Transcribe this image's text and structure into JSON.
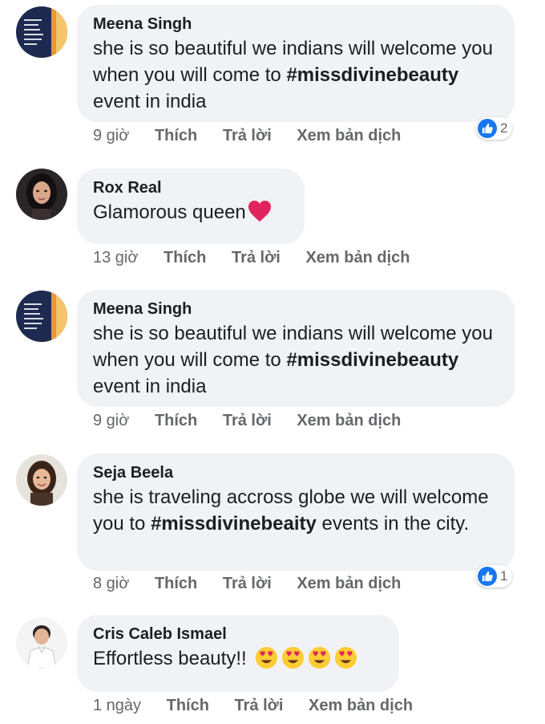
{
  "comments": [
    {
      "author": "Meena Singh",
      "text_1": "she is so beautiful we indians will welcome you when you will come to",
      "hashtag": "#missdivinebeauty",
      "text_2": " event in india",
      "time": "9 giờ",
      "like": "Thích",
      "reply": "Trả lời",
      "translate": "Xem bản dịch",
      "reaction_count": "2",
      "avatar": "book-cover-avatar"
    },
    {
      "author": "Rox Real",
      "text_1": "Glamorous queen",
      "time": "13 giờ",
      "like": "Thích",
      "reply": "Trả lời",
      "translate": "Xem bản dịch",
      "emoji": "red-heart-icon",
      "avatar": "woman-dark-hair-avatar"
    },
    {
      "author": "Meena Singh",
      "text_1": "she is so beautiful we indians will welcome you when you will come to",
      "hashtag": "#missdivinebeauty",
      "text_2": " event in india",
      "time": "9 giờ",
      "like": "Thích",
      "reply": "Trả lời",
      "translate": "Xem bản dịch",
      "avatar": "book-cover-avatar"
    },
    {
      "author": "Seja Beela",
      "text_1": "she is traveling accross globe we will welcome you to",
      "hashtag": "#missdivinebeaity",
      "text_2": " events in the city.",
      "time": "8 giờ",
      "like": "Thích",
      "reply": "Trả lời",
      "translate": "Xem bản dịch",
      "reaction_count": "1",
      "avatar": "woman-smiling-avatar"
    },
    {
      "author": "Cris Caleb Ismael",
      "text_1": "Effortless beauty!!",
      "time": "1 ngày",
      "like": "Thích",
      "reply": "Trả lời",
      "translate": "Xem bản dịch",
      "emoji": "heart-eyes-emoji x4",
      "avatar": "man-white-shirt-avatar"
    }
  ],
  "colors": {
    "bubble": "#f0f2f5",
    "meta_text": "#65676b",
    "like_blue": "#1877f2",
    "heart_red": "#e0245e",
    "emoji_yellow": "#ffcc33"
  }
}
